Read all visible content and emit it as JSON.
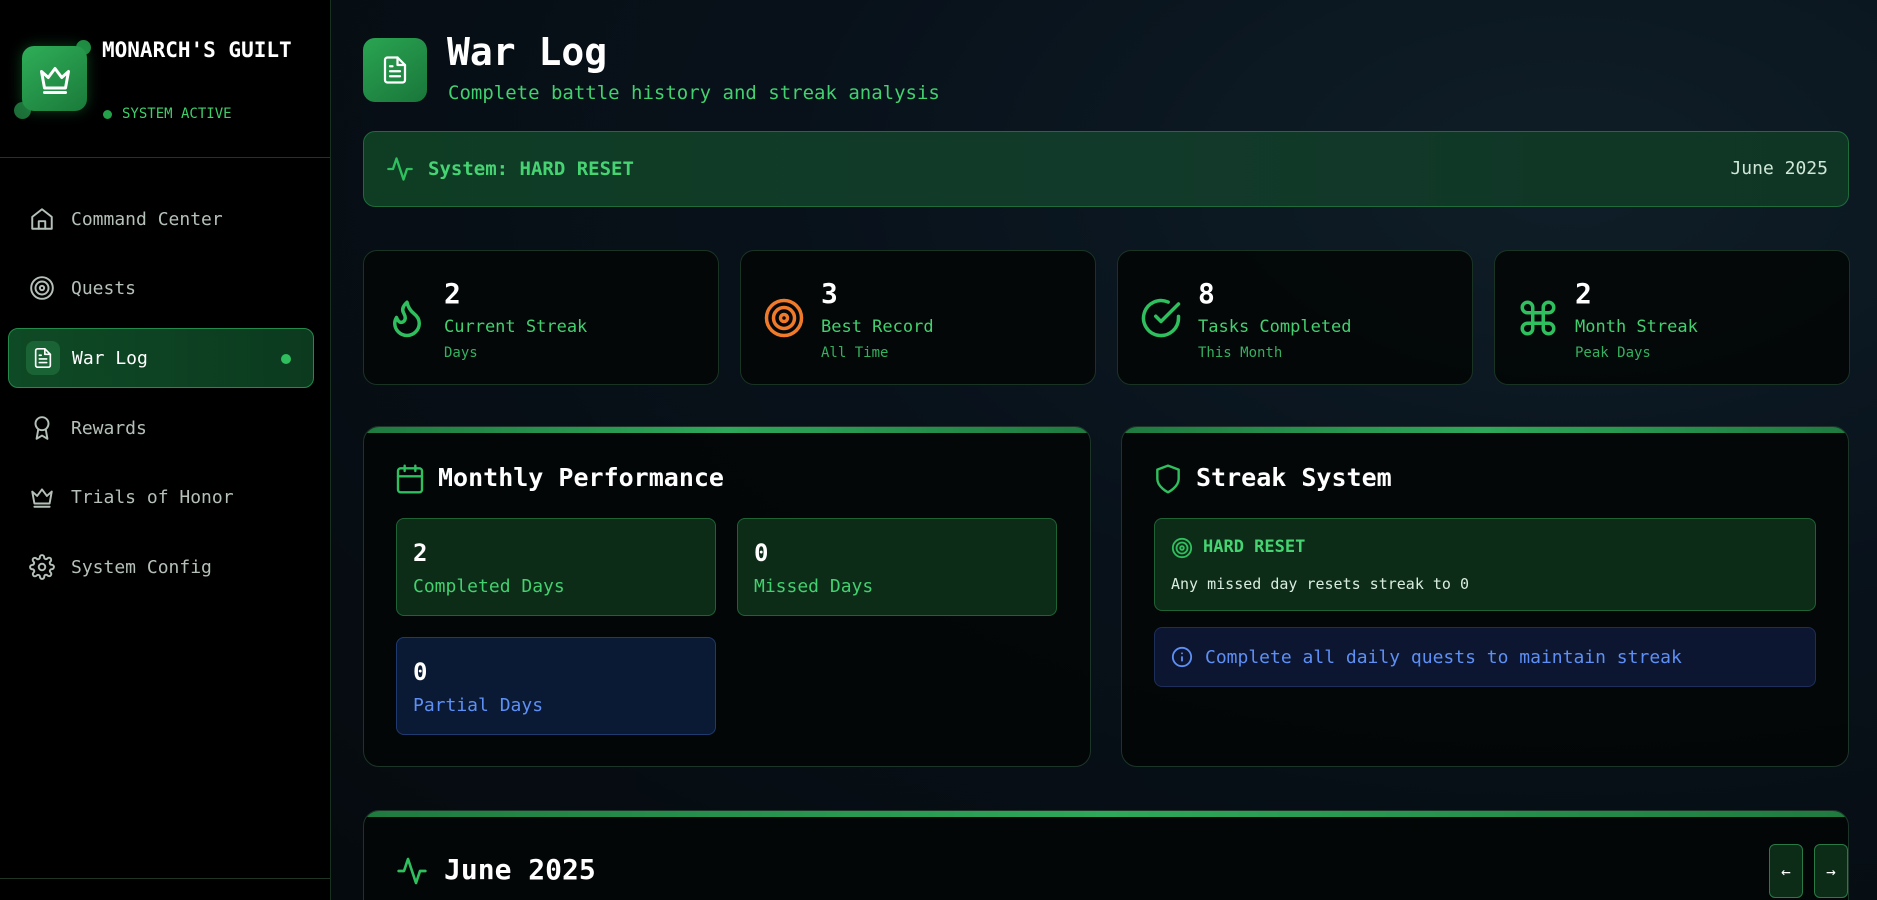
{
  "brand": {
    "name": "MONARCH'S GUILT",
    "status": "SYSTEM ACTIVE"
  },
  "sidebar": {
    "items": [
      {
        "label": "Command Center",
        "icon": "home-icon"
      },
      {
        "label": "Quests",
        "icon": "target-icon"
      },
      {
        "label": "War Log",
        "icon": "document-icon",
        "active": true
      },
      {
        "label": "Rewards",
        "icon": "award-icon"
      },
      {
        "label": "Trials of Honor",
        "icon": "crown-icon"
      },
      {
        "label": "System Config",
        "icon": "gear-icon"
      }
    ]
  },
  "header": {
    "title": "War Log",
    "subtitle": "Complete battle history and streak analysis"
  },
  "banner": {
    "text": "System: HARD RESET",
    "date": "June 2025"
  },
  "stats": [
    {
      "value": "2",
      "label": "Current Streak",
      "sub": "Days",
      "icon": "flame-icon",
      "color": "#2fbf5e"
    },
    {
      "value": "3",
      "label": "Best Record",
      "sub": "All Time",
      "icon": "target-icon",
      "color": "#f07a2a"
    },
    {
      "value": "8",
      "label": "Tasks Completed",
      "sub": "This Month",
      "icon": "check-circle-icon",
      "color": "#2fbf5e"
    },
    {
      "value": "2",
      "label": "Month Streak",
      "sub": "Peak Days",
      "icon": "command-icon",
      "color": "#2fbf5e"
    }
  ],
  "monthly": {
    "title": "Monthly Performance",
    "completed": {
      "value": "2",
      "label": "Completed Days"
    },
    "missed": {
      "value": "0",
      "label": "Missed Days"
    },
    "partial": {
      "value": "0",
      "label": "Partial Days"
    }
  },
  "streak": {
    "title": "Streak System",
    "mode": "HARD RESET",
    "mode_desc": "Any missed day resets streak to 0",
    "info": "Complete all daily quests to maintain streak"
  },
  "calendar": {
    "title": "June 2025",
    "prev_label": "←",
    "next_label": "→"
  },
  "colors": {
    "accent": "#2fbf5e",
    "accent_text": "#43d06f",
    "orange": "#f07a2a",
    "blue": "#5d8ff5"
  }
}
